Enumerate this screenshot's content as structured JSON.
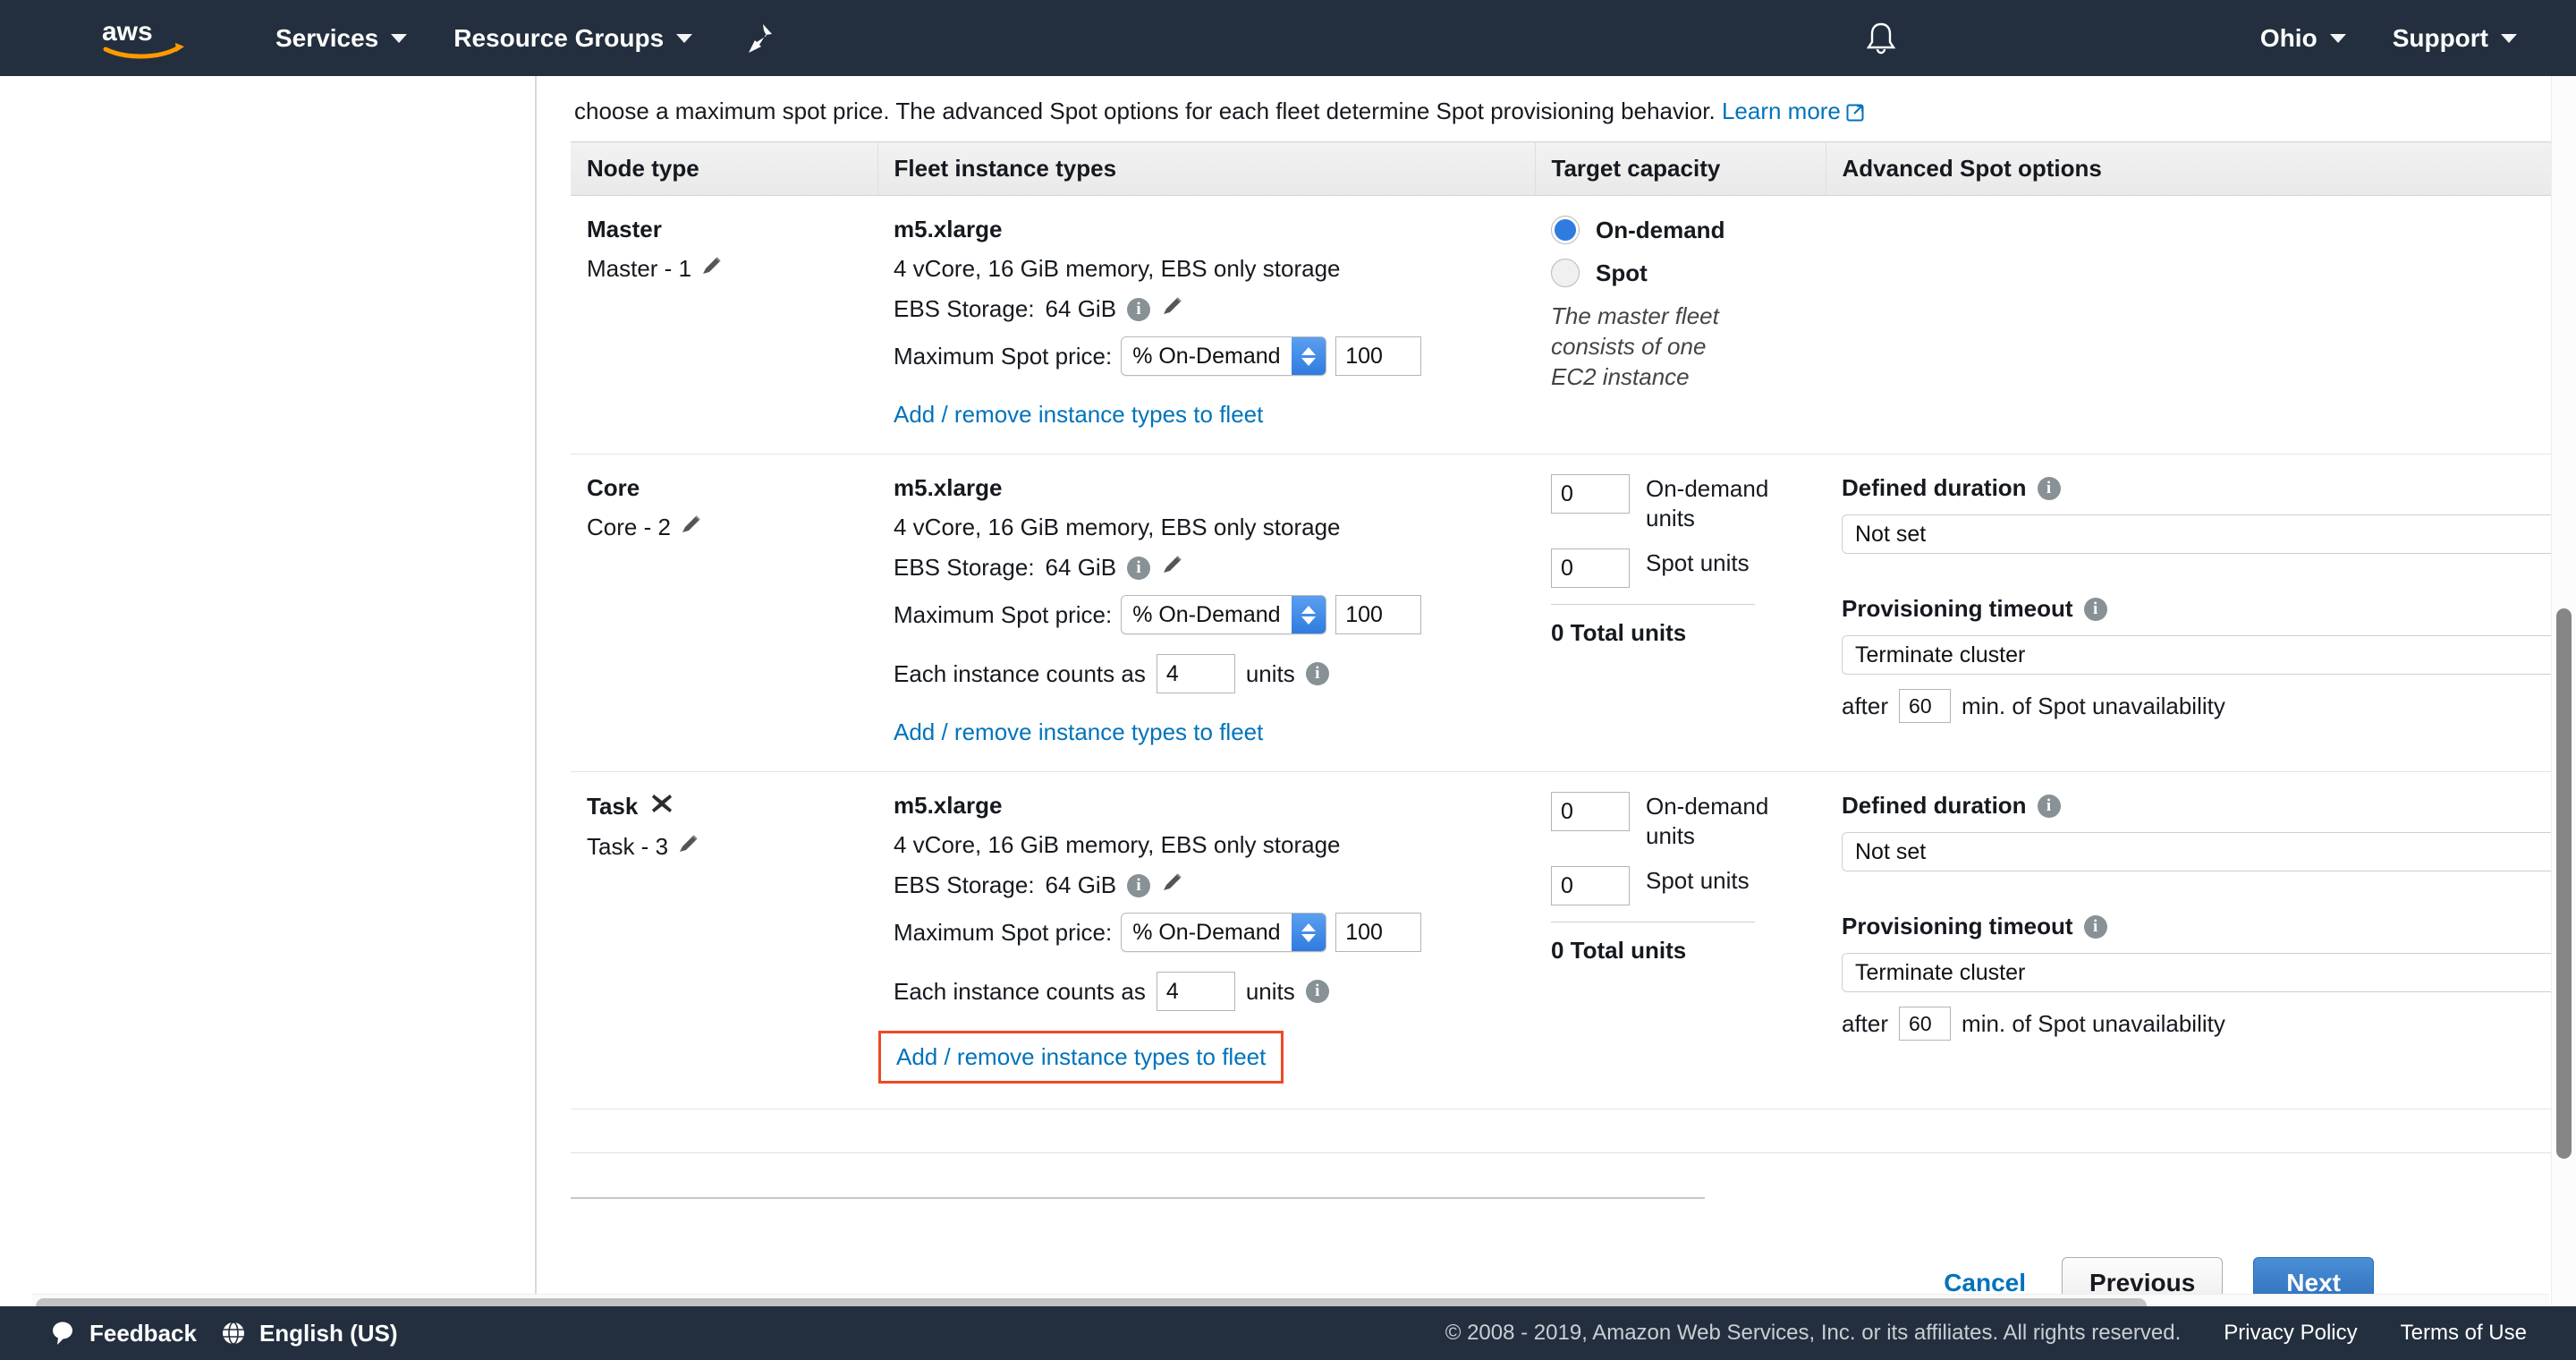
{
  "topnav": {
    "logo": "aws-logo",
    "services_label": "Services",
    "resource_groups_label": "Resource Groups",
    "pin_icon": "pin-icon",
    "bell_icon": "bell-icon",
    "region_label": "Ohio",
    "support_label": "Support"
  },
  "intro": {
    "text": "choose a maximum spot price. The advanced Spot options for each fleet determine Spot provisioning behavior.",
    "learn_more": "Learn more"
  },
  "table": {
    "headers": {
      "node_type": "Node type",
      "fleet_instance_types": "Fleet instance types",
      "target_capacity": "Target capacity",
      "advanced_spot_options": "Advanced Spot options"
    },
    "rows": [
      {
        "node": {
          "title": "Master",
          "subtitle": "Master - 1"
        },
        "fleet": {
          "instance_name": "m5.xlarge",
          "spec": "4 vCore, 16 GiB memory, EBS only storage",
          "ebs_label": "EBS Storage:",
          "ebs_value": "64 GiB",
          "spot_price_label": "Maximum Spot price:",
          "spot_price_unit": "% On-Demand",
          "spot_price_value": "100",
          "add_remove_link": "Add / remove instance types to fleet"
        },
        "capacity": {
          "mode": "radio",
          "ondemand_label": "On-demand",
          "spot_label": "Spot",
          "selected": "On-demand",
          "note": "The master fleet consists of one EC2 instance"
        },
        "advanced": null
      },
      {
        "node": {
          "title": "Core",
          "subtitle": "Core - 2"
        },
        "fleet": {
          "instance_name": "m5.xlarge",
          "spec": "4 vCore, 16 GiB memory, EBS only storage",
          "ebs_label": "EBS Storage:",
          "ebs_value": "64 GiB",
          "spot_price_label": "Maximum Spot price:",
          "spot_price_unit": "% On-Demand",
          "spot_price_value": "100",
          "counts_prefix": "Each instance counts as",
          "counts_value": "4",
          "counts_suffix": "units",
          "add_remove_link": "Add / remove instance types to fleet"
        },
        "capacity": {
          "mode": "units",
          "ondemand_units_value": "0",
          "ondemand_units_label": "On-demand units",
          "spot_units_value": "0",
          "spot_units_label": "Spot units",
          "total_label": "0 Total units"
        },
        "advanced": {
          "defined_duration_label": "Defined duration",
          "defined_duration_value": "Not set",
          "provisioning_timeout_label": "Provisioning timeout",
          "provisioning_timeout_value": "Terminate cluster",
          "after_prefix": "after",
          "after_value": "60",
          "after_suffix": "min. of Spot unavailability"
        }
      },
      {
        "node": {
          "title": "Task",
          "subtitle": "Task - 3",
          "removable": true
        },
        "fleet": {
          "instance_name": "m5.xlarge",
          "spec": "4 vCore, 16 GiB memory, EBS only storage",
          "ebs_label": "EBS Storage:",
          "ebs_value": "64 GiB",
          "spot_price_label": "Maximum Spot price:",
          "spot_price_unit": "% On-Demand",
          "spot_price_value": "100",
          "counts_prefix": "Each instance counts as",
          "counts_value": "4",
          "counts_suffix": "units",
          "add_remove_link": "Add / remove instance types to fleet",
          "link_highlighted": true
        },
        "capacity": {
          "mode": "units",
          "ondemand_units_value": "0",
          "ondemand_units_label": "On-demand units",
          "spot_units_value": "0",
          "spot_units_label": "Spot units",
          "total_label": "0 Total units"
        },
        "advanced": {
          "defined_duration_label": "Defined duration",
          "defined_duration_value": "Not set",
          "provisioning_timeout_label": "Provisioning timeout",
          "provisioning_timeout_value": "Terminate cluster",
          "after_prefix": "after",
          "after_value": "60",
          "after_suffix": "min. of Spot unavailability"
        }
      }
    ]
  },
  "actions": {
    "cancel": "Cancel",
    "previous": "Previous",
    "next": "Next"
  },
  "bottombar": {
    "feedback": "Feedback",
    "language": "English (US)",
    "copyright": "© 2008 - 2019, Amazon Web Services, Inc. or its affiliates. All rights reserved.",
    "privacy_policy": "Privacy Policy",
    "terms_of_use": "Terms of Use"
  },
  "colors": {
    "nav_bg": "#232f3e",
    "link_blue": "#0073bb",
    "accent_blue": "#2f7be0",
    "highlight_red": "#ec4a26"
  }
}
